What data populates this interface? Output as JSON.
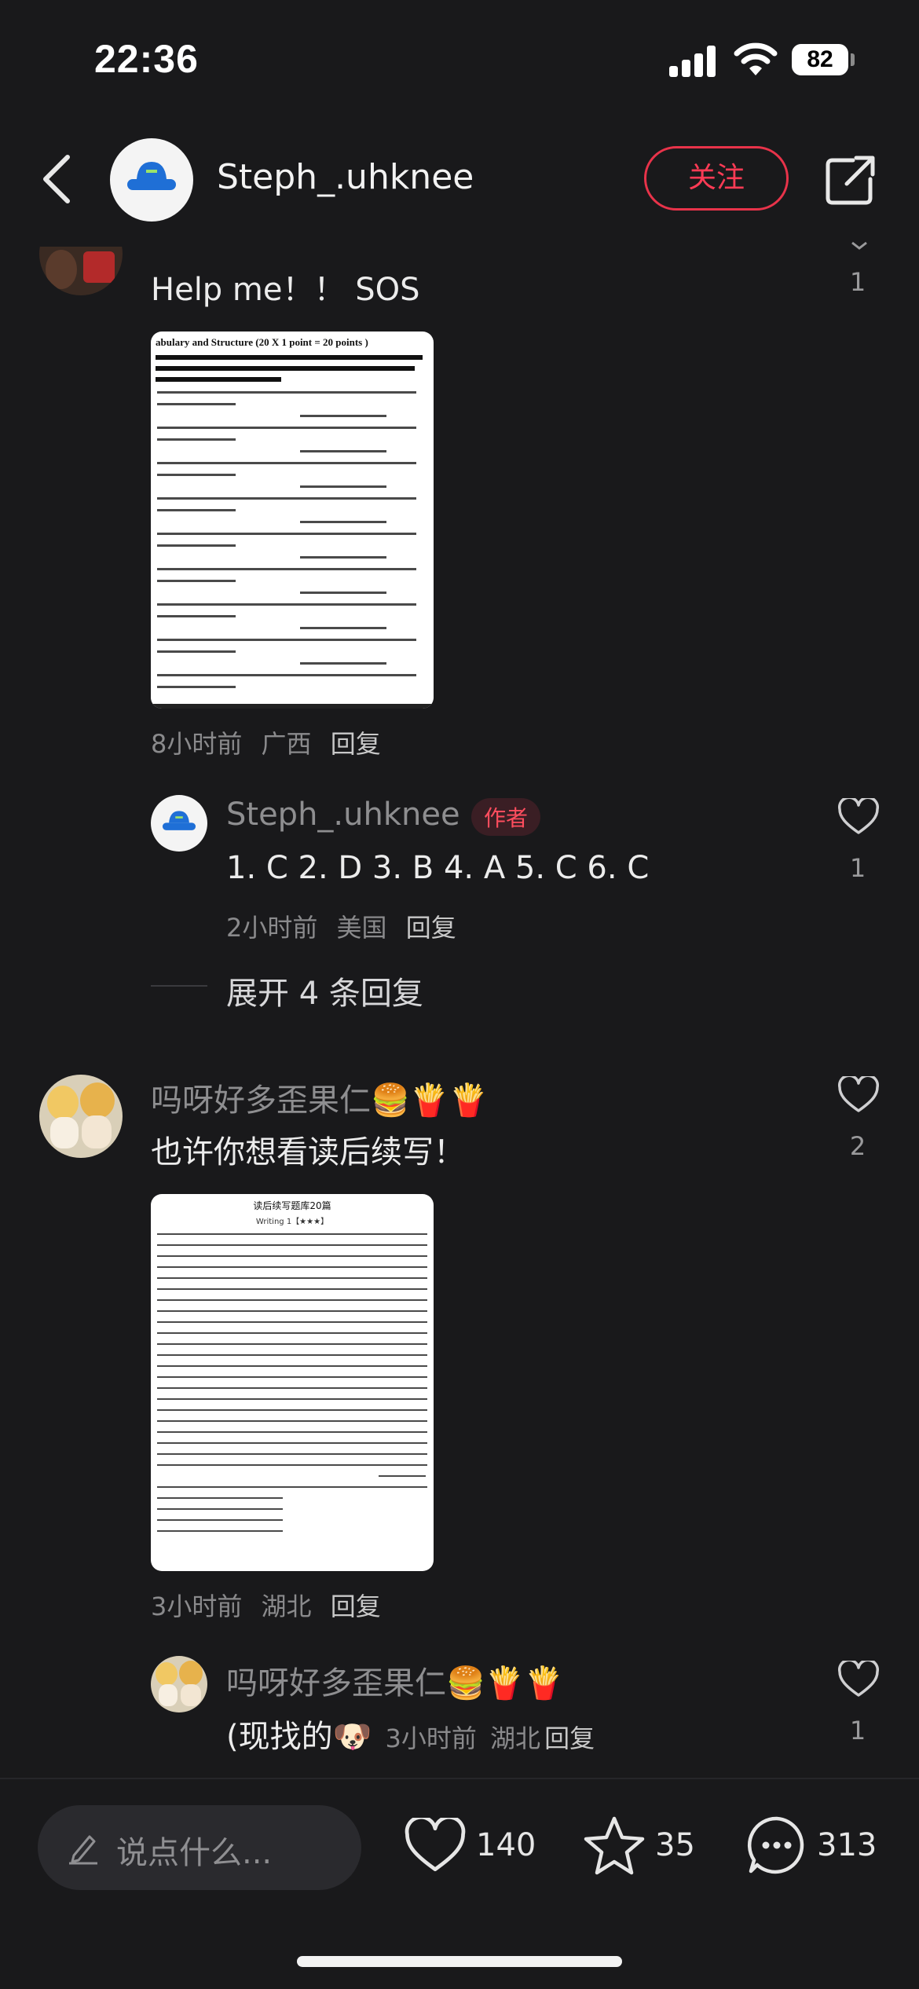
{
  "status_bar": {
    "time": "22:36",
    "battery": "82"
  },
  "header": {
    "username": "Steph_.uhknee",
    "follow_label": "关注"
  },
  "comment1": {
    "text": "Help me！！ SOS",
    "likes": "1",
    "time": "8小时前",
    "location": "广西",
    "reply_label": "回复",
    "image_caption": "abulary and Structure (20 X 1 point = 20 points )"
  },
  "reply1": {
    "nickname": "Steph_.uhknee",
    "author_tag": "作者",
    "text": "1. C 2. D 3. B 4. A 5. C 6. C",
    "likes": "1",
    "time": "2小时前",
    "location": "美国",
    "reply_label": "回复"
  },
  "expand": {
    "label": "展开 4 条回复"
  },
  "comment2": {
    "nickname": "吗呀好多歪果仁🍔🍟🍟",
    "text": "也许你想看读后续写！",
    "likes": "2",
    "time": "3小时前",
    "location": "湖北",
    "reply_label": "回复",
    "image_title": "读后续写题库20篇",
    "image_subtitle": "Writing 1【★★★】"
  },
  "reply2": {
    "nickname": "吗呀好多歪果仁🍔🍟🍟",
    "text": "(现找的🐶",
    "likes": "1",
    "time": "3小时前",
    "location": "湖北",
    "reply_label": "回复"
  },
  "bottom_bar": {
    "input_placeholder": "说点什么...",
    "likes": "140",
    "stars": "35",
    "comments": "313"
  },
  "colors": {
    "background": "#19191b",
    "accent": "#ff3b55"
  }
}
